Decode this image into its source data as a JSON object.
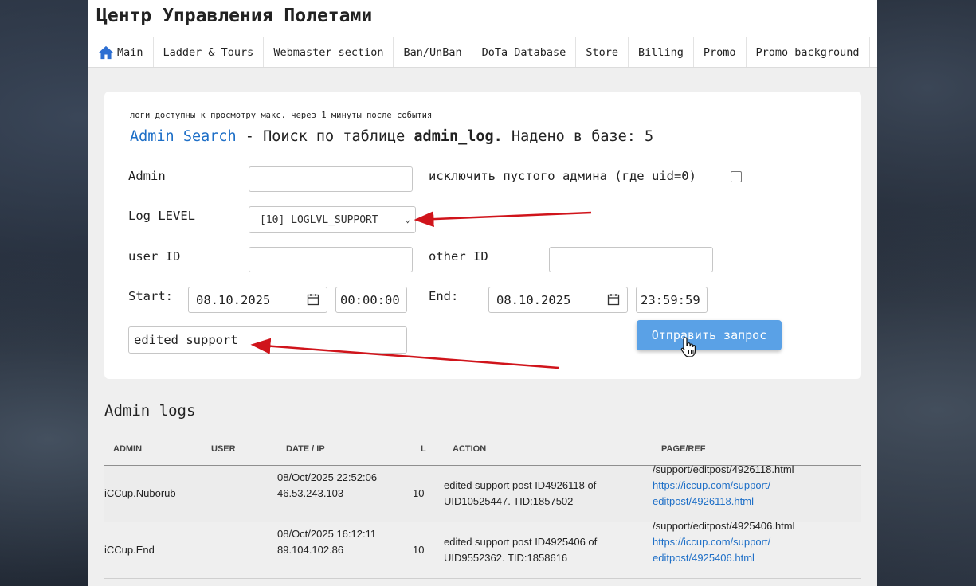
{
  "site": {
    "title": "Центр Управления Полетами"
  },
  "nav": {
    "items": [
      {
        "label": "Main",
        "icon": "home-icon"
      },
      {
        "label": "Ladder & Tours"
      },
      {
        "label": "Webmaster section"
      },
      {
        "label": "Ban/UnBan"
      },
      {
        "label": "DoTa Database"
      },
      {
        "label": "Store"
      },
      {
        "label": "Billing"
      },
      {
        "label": "Promo"
      },
      {
        "label": "Promo background"
      }
    ]
  },
  "search": {
    "note": "логи доступны к просмотру макс. через 1 минуты после события",
    "heading_link": "Admin Search",
    "heading_text": " - Поиск по таблице ",
    "heading_table": "admin_log.",
    "heading_found": " Надено в базе: 5",
    "admin_label": "Admin",
    "admin_value": "",
    "exclude_label": "исключить пустого админа (где uid=0)",
    "exclude_checked": false,
    "loglevel_label": "Log LEVEL",
    "loglevel_value": "[10] LOGLVL_SUPPORT",
    "userid_label": "user ID",
    "userid_value": "",
    "otherid_label": "other ID",
    "otherid_value": "",
    "start_label": "Start:",
    "start_date": "08.10.2025",
    "start_time": "00:00:00",
    "end_label": "End:",
    "end_date": "08.10.2025",
    "end_time": "23:59:59",
    "query_value": "edited support",
    "submit_label": "Отправить запрос"
  },
  "logs": {
    "title": "Admin logs",
    "columns": [
      "ADMIN",
      "USER",
      "DATE / IP",
      "L",
      "ACTION",
      "PAGE/REF"
    ],
    "rows": [
      {
        "admin": "iCCup.Nuborub",
        "user": "",
        "date": "08/Oct/2025 22:52:06",
        "ip": "46.53.243.103",
        "level": "10",
        "action_1": "edited support post ID4926118 of",
        "action_2": "UID10525447. TID:1857502",
        "page": "/support/editpost/4926118.html",
        "ref_1": "https://iccup.com/support/",
        "ref_2": "editpost/4926118.html"
      },
      {
        "admin": "iCCup.End",
        "user": "",
        "date": "08/Oct/2025 16:12:11",
        "ip": "89.104.102.86",
        "level": "10",
        "action_1": "edited support post ID4925406 of",
        "action_2": "UID9552362. TID:1858616",
        "page": "/support/editpost/4925406.html",
        "ref_1": "https://iccup.com/support/",
        "ref_2": "editpost/4925406.html"
      }
    ]
  },
  "colors": {
    "accent": "#1e6fc7",
    "button": "#5aa1e6",
    "annotation": "#d0141b"
  }
}
